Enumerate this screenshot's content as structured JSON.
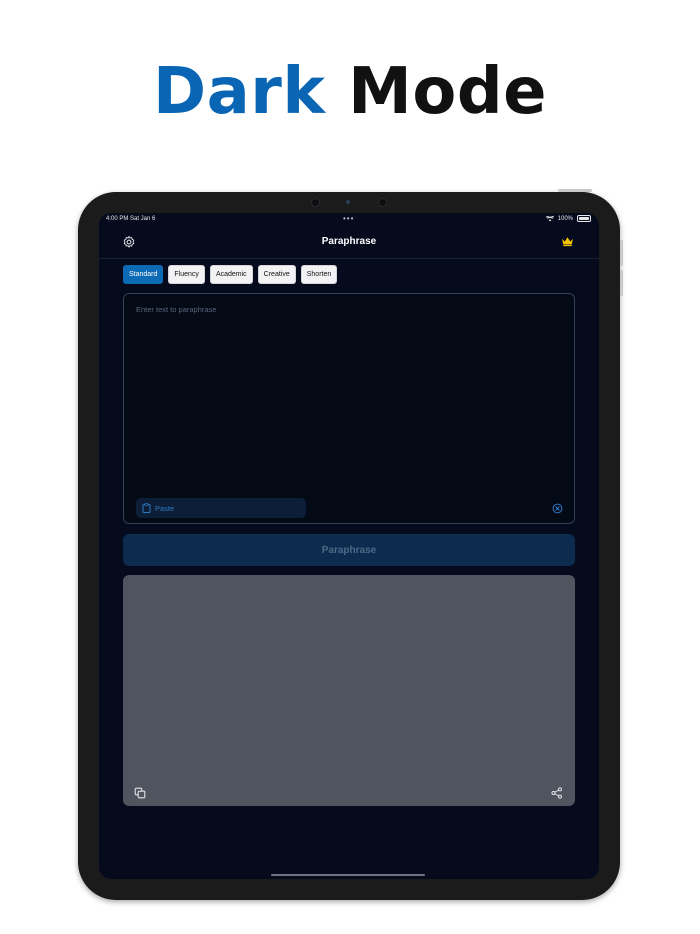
{
  "headline": {
    "accent_word": "Dark",
    "rest_word": "Mode"
  },
  "status_bar": {
    "time_date": "4:00 PM  Sat Jan 6",
    "more": "•••",
    "battery": "100%"
  },
  "navbar": {
    "title": "Paraphrase",
    "settings_icon": "gear-icon",
    "premium_icon": "crown-icon"
  },
  "modes": [
    {
      "label": "Standard",
      "active": true
    },
    {
      "label": "Fluency",
      "active": false
    },
    {
      "label": "Academic",
      "active": false
    },
    {
      "label": "Creative",
      "active": false
    },
    {
      "label": "Shorten",
      "active": false
    }
  ],
  "input": {
    "placeholder": "Enter text to paraphrase",
    "paste_label": "Paste"
  },
  "action": {
    "paraphrase_label": "Paraphrase"
  },
  "colors": {
    "accent": "#0a66b4",
    "screen_bg": "#050a1c",
    "button_disabled": "#0c2b4e",
    "output_bg": "#50545e",
    "crown": "#f2c300"
  }
}
